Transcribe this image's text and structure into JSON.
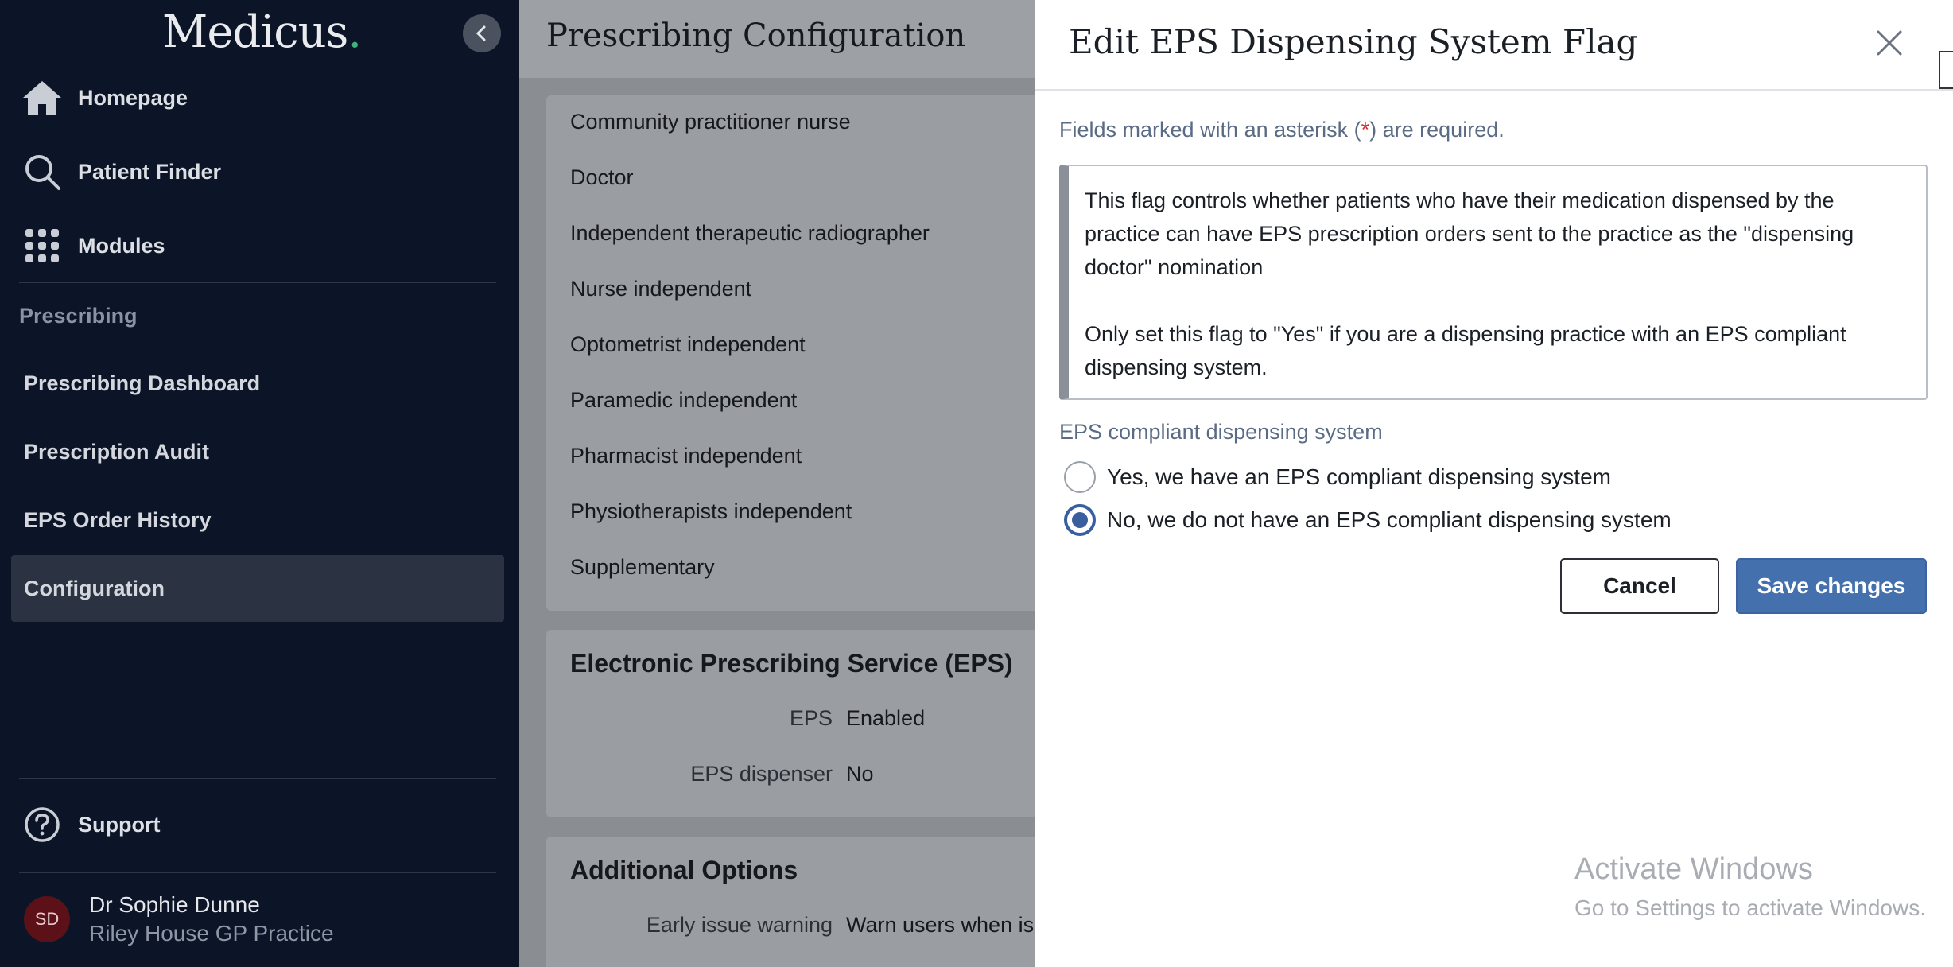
{
  "sidebar": {
    "brand": "Medicus",
    "brand_dot": ".",
    "nav": [
      {
        "label": "Homepage",
        "icon": "home-icon"
      },
      {
        "label": "Patient Finder",
        "icon": "search-icon"
      },
      {
        "label": "Modules",
        "icon": "grid-icon"
      }
    ],
    "section_label": "Prescribing",
    "sub_items": [
      {
        "label": "Prescribing Dashboard"
      },
      {
        "label": "Prescription Audit"
      },
      {
        "label": "EPS Order History"
      },
      {
        "label": "Configuration",
        "active": true
      }
    ],
    "support_label": "Support",
    "user": {
      "initials": "SD",
      "name": "Dr Sophie Dunne",
      "practice": "Riley House GP Practice"
    }
  },
  "page": {
    "title": "Prescribing Configuration",
    "prescriber_types": [
      "Community practitioner nurse",
      "Doctor",
      "Independent therapeutic radiographer",
      "Nurse independent",
      "Optometrist independent",
      "Paramedic independent",
      "Pharmacist independent",
      "Physiotherapists independent",
      "Supplementary"
    ],
    "eps_card": {
      "title": "Electronic Prescribing Service (EPS)",
      "rows": [
        {
          "key": "EPS",
          "value": "Enabled"
        },
        {
          "key": "EPS dispenser",
          "value": "No"
        }
      ]
    },
    "additional_card": {
      "title": "Additional Options",
      "rows": [
        {
          "key": "Early issue warning",
          "value": "Warn users when is"
        }
      ]
    }
  },
  "modal": {
    "title": "Edit EPS Dispensing System Flag",
    "required_note_pre": "Fields marked with an asterisk (",
    "required_note_ast": "*",
    "required_note_post": ") are required.",
    "info_p1": "This flag controls whether patients who have their medication dispensed by the practice can have EPS prescription orders sent to the practice as the \"dispensing doctor\" nomination",
    "info_p2": "Only set this flag to \"Yes\" if you are a dispensing practice with an EPS compliant dispensing system.",
    "group_label": "EPS compliant dispensing system",
    "options": [
      {
        "label": "Yes, we have an EPS compliant dispensing system",
        "checked": false
      },
      {
        "label": "No, we do not have an EPS compliant dispensing system",
        "checked": true
      }
    ],
    "cancel_label": "Cancel",
    "save_label": "Save changes"
  },
  "watermark": {
    "line1": "Activate Windows",
    "line2": "Go to Settings to activate Windows."
  },
  "colors": {
    "sidebar_bg": "#0c1527",
    "primary": "#4470ad",
    "brand_dot": "#3fb47a"
  }
}
